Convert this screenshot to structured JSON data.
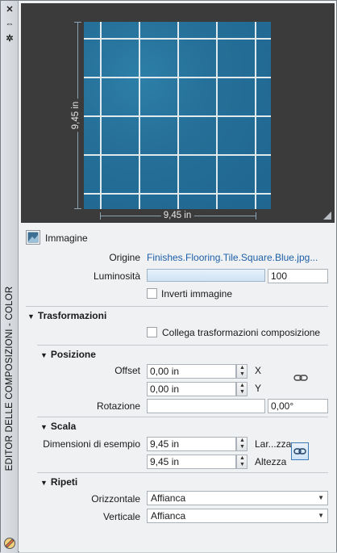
{
  "palette": {
    "vertical_title": "EDITOR DELLE COMPOSIZIONI - COLOR",
    "close_glyph": "✕",
    "pin_glyph": "⇔",
    "settings_glyph": "✲"
  },
  "preview": {
    "dim_vertical": "9,45 in",
    "dim_horizontal": "9,45 in"
  },
  "image_section": {
    "title": "Immagine",
    "origin_label": "Origine",
    "origin_value": "Finishes.Flooring.Tile.Square.Blue.jpg...",
    "brightness_label": "Luminosità",
    "brightness_value": "100",
    "brightness_level": 0.5,
    "invert_label": "Inverti immagine",
    "invert_checked": false
  },
  "transformations": {
    "title": "Trasformazioni",
    "link_label": "Collega trasformazioni composizione",
    "link_checked": false,
    "position": {
      "title": "Posizione",
      "offset_label": "Offset",
      "offset_x": "0,00 in",
      "offset_x_axis": "X",
      "offset_y": "0,00 in",
      "offset_y_axis": "Y",
      "rotation_label": "Rotazione",
      "rotation_value": "0,00°"
    },
    "scale": {
      "title": "Scala",
      "sample_label": "Dimensioni di esempio",
      "width_value": "9,45 in",
      "width_label": "Lar...zza",
      "height_value": "9,45 in",
      "height_label": "Altezza"
    },
    "repeat": {
      "title": "Ripeti",
      "horizontal_label": "Orizzontale",
      "horizontal_value": "Affianca",
      "vertical_label": "Verticale",
      "vertical_value": "Affianca"
    }
  },
  "colors": {
    "tile": "#256f98",
    "link": "#1d5fa8",
    "preview_bg": "#3b3b3b"
  }
}
